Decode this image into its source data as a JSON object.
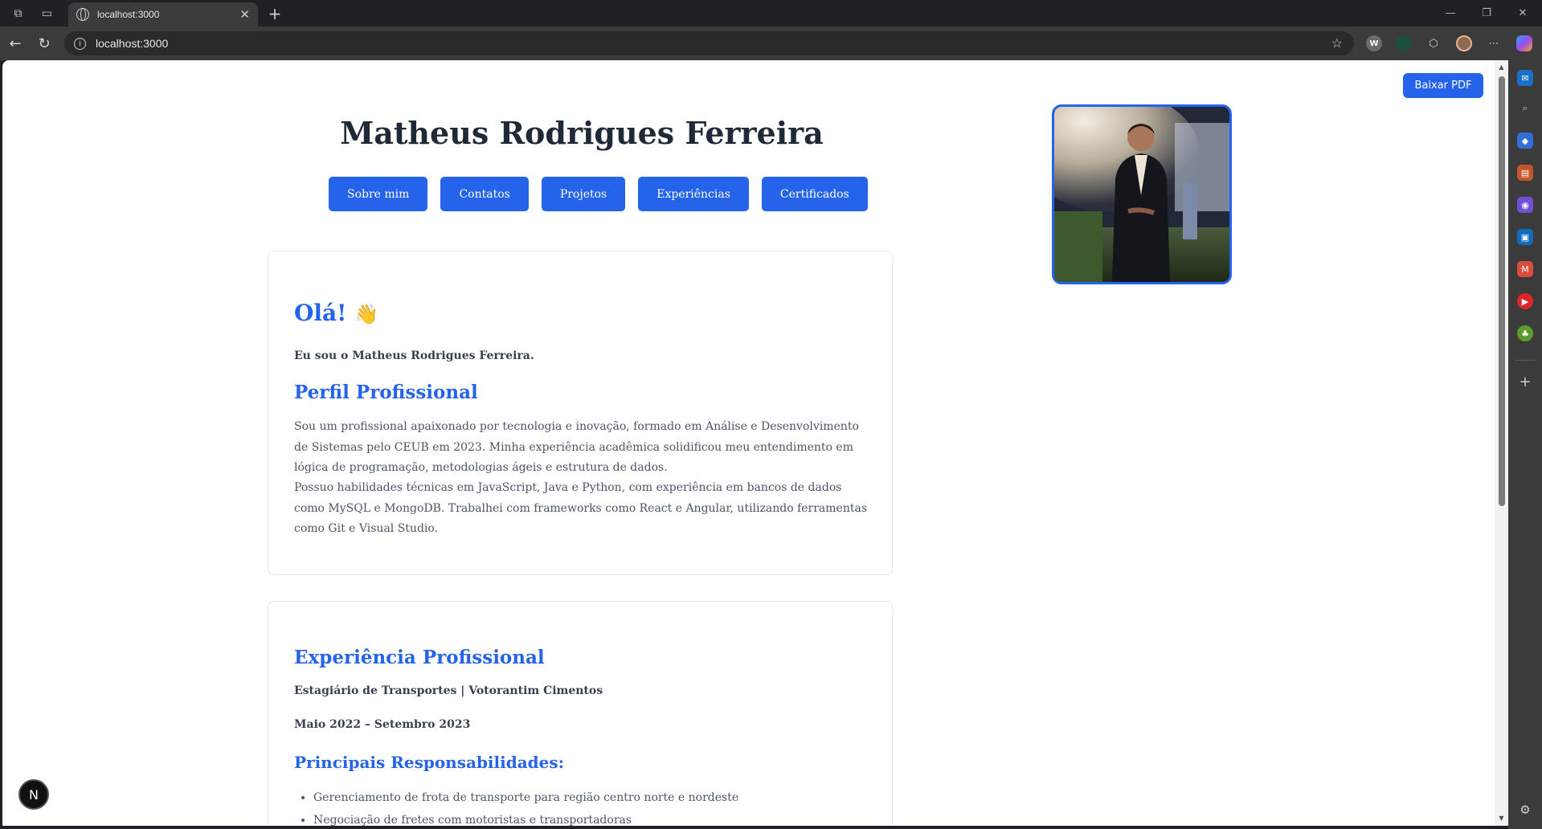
{
  "browser": {
    "tab_title": "localhost:3000",
    "tab_close": "✕",
    "new_tab": "+",
    "url": "localhost:3000",
    "info": "i",
    "star": "☆",
    "ext_w": "W",
    "more": "⋯",
    "minimize": "—",
    "restore": "❐",
    "close": "✕"
  },
  "page": {
    "download_pdf": "Baixar PDF",
    "name": "Matheus Rodrigues Ferreira",
    "nav": [
      "Sobre mim",
      "Contatos",
      "Projetos",
      "Experiências",
      "Certificados"
    ],
    "about": {
      "greeting": "Olá!",
      "wave": "👋",
      "intro": "Eu sou o Matheus Rodrigues Ferreira.",
      "profile_heading": "Perfil Profissional",
      "p1": "Sou um profissional apaixonado por tecnologia e inovação, formado em Análise e Desenvolvimento de Sistemas pelo CEUB em 2023. Minha experiência acadêmica solidificou meu entendimento em lógica de programação, metodologias ágeis e estrutura de dados.",
      "p2": "Possuo habilidades técnicas em JavaScript, Java e Python, com experiência em bancos de dados como MySQL e MongoDB. Trabalhei com frameworks como React e Angular, utilizando ferramentas como Git e Visual Studio."
    },
    "experience": {
      "heading": "Experiência Profissional",
      "role": "Estagiário de Transportes | Votorantim Cimentos",
      "period": "Maio 2022 – Setembro 2023",
      "resp_heading": "Principais Responsabilidades:",
      "items": [
        "Gerenciamento de frota de transporte para região centro norte e nordeste",
        "Negociação de fretes com motoristas e transportadoras"
      ]
    },
    "next_badge": "N"
  }
}
